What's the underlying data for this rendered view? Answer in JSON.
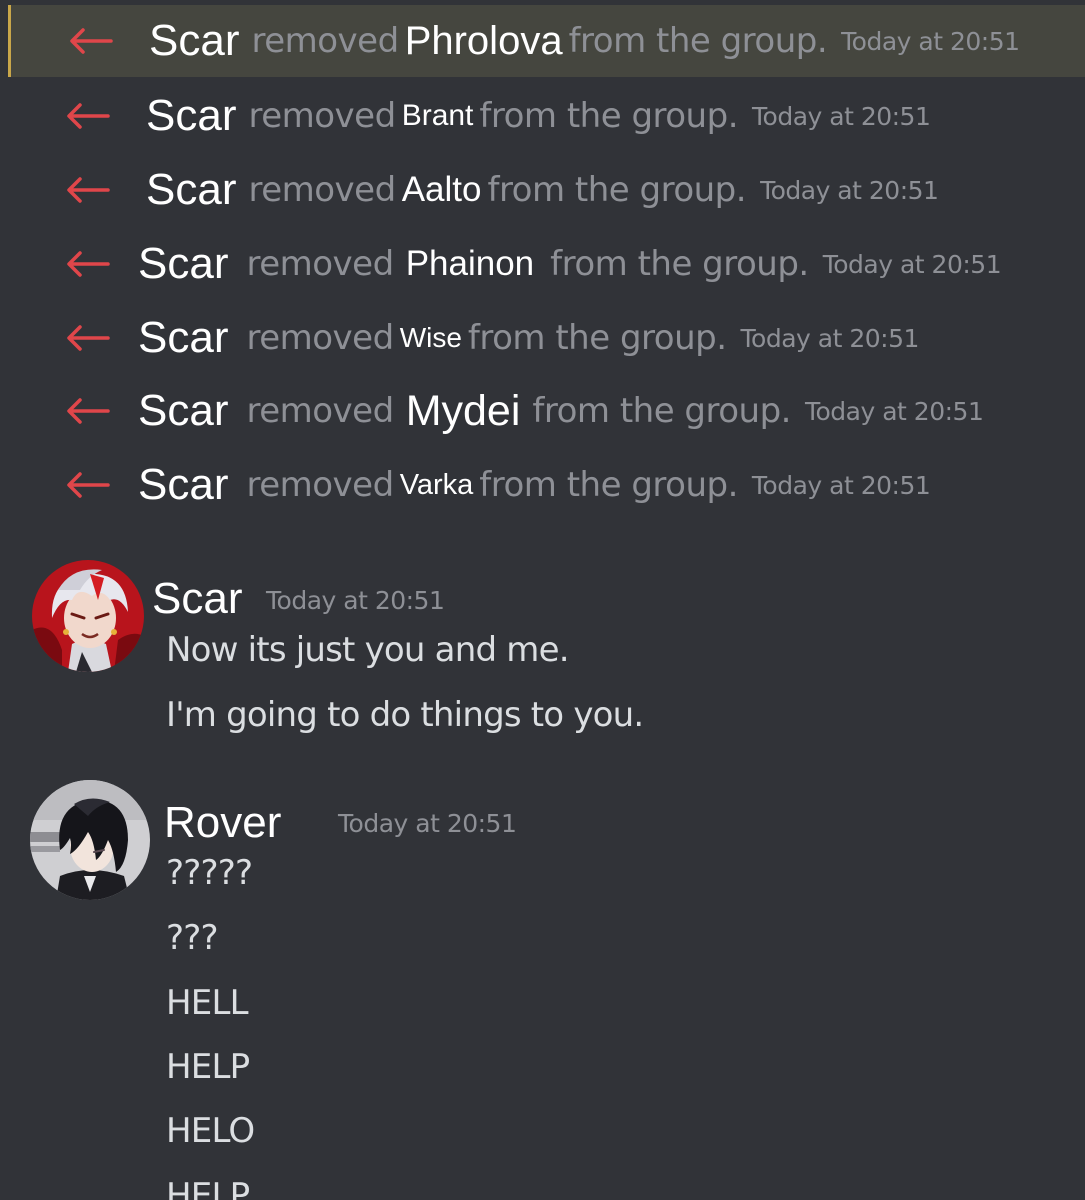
{
  "colors": {
    "background": "#313338",
    "highlight_row": "#45463f",
    "highlight_bar": "#c9a74a",
    "removed_arrow": "#e0464a",
    "muted_text": "#8e9096",
    "username": "#ffffff"
  },
  "system_messages": [
    {
      "icon": "arrow-left-icon",
      "actor": "Scar",
      "verb": "removed",
      "target": "Phrolova",
      "rest": "from the group.",
      "timestamp": "Today at 20:51"
    },
    {
      "icon": "arrow-left-icon",
      "actor": "Scar",
      "verb": "removed",
      "target": "Brant",
      "rest": "from the group.",
      "timestamp": "Today at 20:51"
    },
    {
      "icon": "arrow-left-icon",
      "actor": "Scar",
      "verb": "removed",
      "target": "Aalto",
      "rest": "from the group.",
      "timestamp": "Today at 20:51"
    },
    {
      "icon": "arrow-left-icon",
      "actor": "Scar",
      "verb": "removed",
      "target": "Phainon",
      "rest": "from the group.",
      "timestamp": "Today at 20:51"
    },
    {
      "icon": "arrow-left-icon",
      "actor": "Scar",
      "verb": "removed",
      "target": "Wise",
      "rest": "from the group.",
      "timestamp": "Today at 20:51"
    },
    {
      "icon": "arrow-left-icon",
      "actor": "Scar",
      "verb": "removed",
      "target": "Mydei",
      "rest": "from the group.",
      "timestamp": "Today at 20:51"
    },
    {
      "icon": "arrow-left-icon",
      "actor": "Scar",
      "verb": "removed",
      "target": "Varka",
      "rest": "from the group.",
      "timestamp": "Today at 20:51"
    }
  ],
  "messages": [
    {
      "author": "Scar",
      "timestamp": "Today at 20:51",
      "lines": [
        "Now its just you and me.",
        "I'm going to do things to you."
      ]
    },
    {
      "author": "Rover",
      "timestamp": "Today at 20:51",
      "lines": [
        "?????",
        "???",
        "HELL",
        "HELP",
        "HELO",
        "HELP"
      ]
    }
  ]
}
